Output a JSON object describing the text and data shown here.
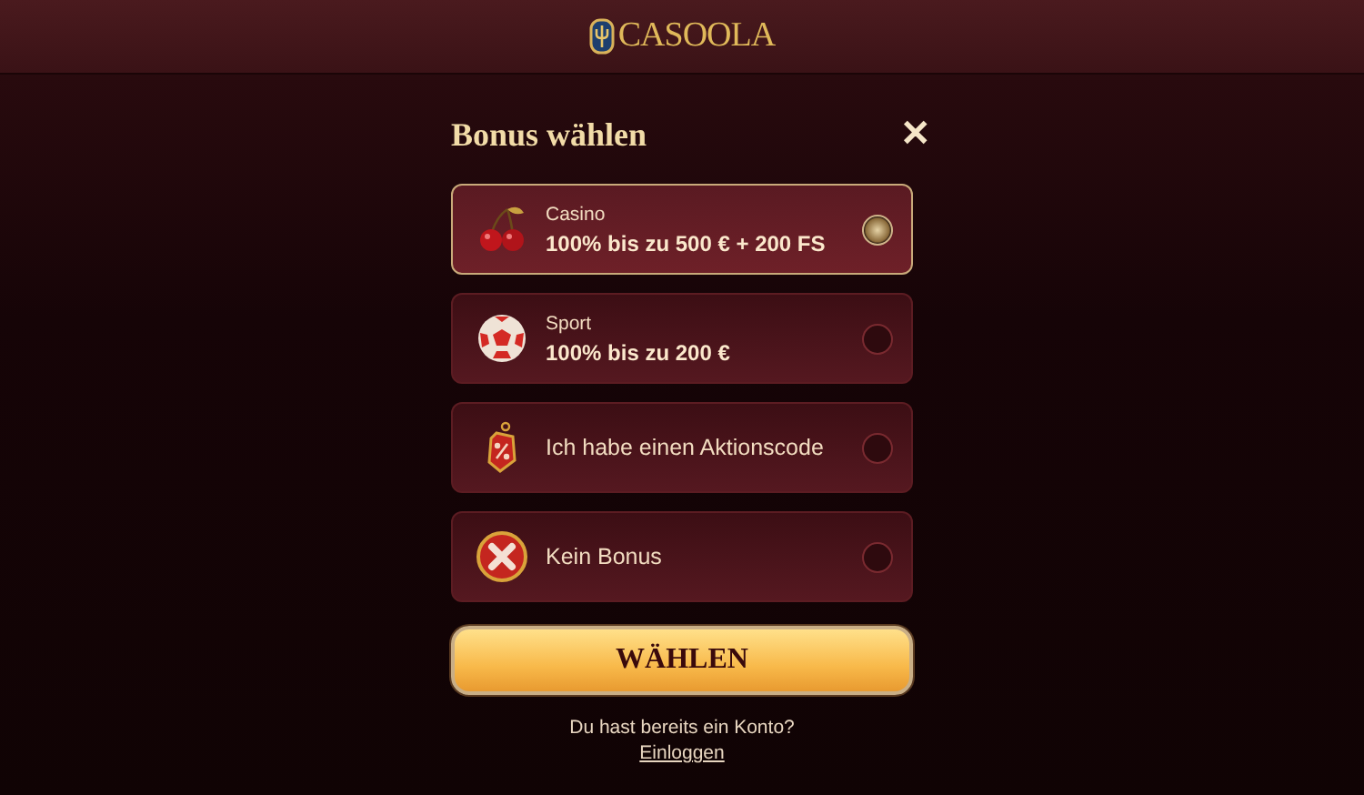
{
  "header": {
    "logo": "CASOOLA"
  },
  "dialog": {
    "title": "Bonus wählen",
    "close": "✕",
    "options": [
      {
        "kind": "cherry",
        "label": "Casino",
        "value": "100% bis zu 500 € + 200 FS",
        "selected": true
      },
      {
        "kind": "ball",
        "label": "Sport",
        "value": "100% bis zu 200 €",
        "selected": false
      },
      {
        "kind": "tag",
        "label": "Ich habe einen Aktionscode",
        "selected": false
      },
      {
        "kind": "cross",
        "label": "Kein Bonus",
        "selected": false
      }
    ],
    "submit": "WÄHLEN",
    "account_prompt": "Du hast bereits ein Konto?",
    "login_link": "Einloggen"
  }
}
